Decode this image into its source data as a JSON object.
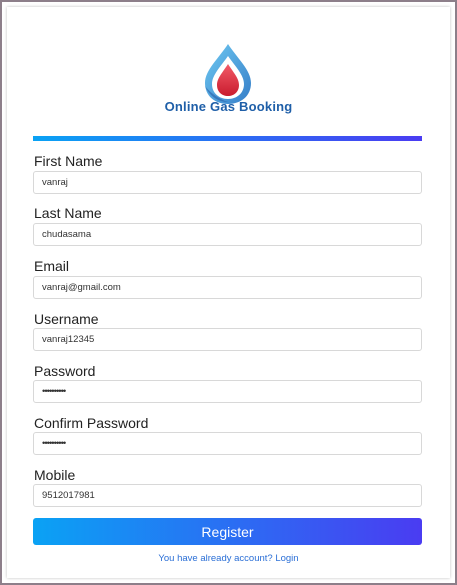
{
  "brand": {
    "name": "Online Gas Booking"
  },
  "form": {
    "fields": [
      {
        "label": "First Name",
        "value": "vanraj"
      },
      {
        "label": "Last Name",
        "value": "chudasama"
      },
      {
        "label": "Email",
        "value": "vanraj@gmail.com"
      },
      {
        "label": "Username",
        "value": "vanraj12345"
      },
      {
        "label": "Password",
        "value": "••••••••••"
      },
      {
        "label": "Confirm Password",
        "value": "••••••••••"
      },
      {
        "label": "Mobile",
        "value": "9512017981"
      }
    ],
    "register_label": "Register",
    "login_link_text": "You have already account? Login"
  },
  "colors": {
    "gradient_start": "#0aa2f4",
    "gradient_end": "#4a3cf2",
    "link": "#2b6fd6",
    "brand_text": "#1f5fa8",
    "drop_outer": "#3aa3e6",
    "drop_inner": "#e03040"
  }
}
